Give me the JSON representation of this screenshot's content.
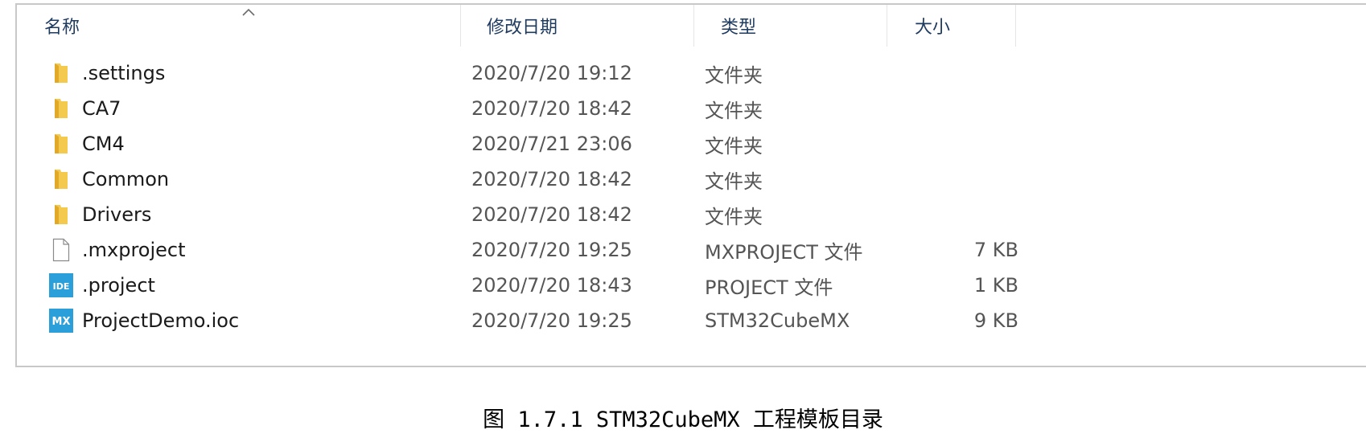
{
  "headers": {
    "name": "名称",
    "date": "修改日期",
    "type": "类型",
    "size": "大小"
  },
  "files": [
    {
      "name": ".settings",
      "date": "2020/7/20 19:12",
      "type": "文件夹",
      "size": "",
      "icon": "folder-icon"
    },
    {
      "name": "CA7",
      "date": "2020/7/20 18:42",
      "type": "文件夹",
      "size": "",
      "icon": "folder-icon"
    },
    {
      "name": "CM4",
      "date": "2020/7/21 23:06",
      "type": "文件夹",
      "size": "",
      "icon": "folder-icon"
    },
    {
      "name": "Common",
      "date": "2020/7/20 18:42",
      "type": "文件夹",
      "size": "",
      "icon": "folder-icon"
    },
    {
      "name": "Drivers",
      "date": "2020/7/20 18:42",
      "type": "文件夹",
      "size": "",
      "icon": "folder-icon"
    },
    {
      "name": ".mxproject",
      "date": "2020/7/20 19:25",
      "type": "MXPROJECT 文件",
      "size": "7 KB",
      "icon": "file-icon"
    },
    {
      "name": ".project",
      "date": "2020/7/20 18:43",
      "type": "PROJECT 文件",
      "size": "1 KB",
      "icon": "ide-icon"
    },
    {
      "name": "ProjectDemo.ioc",
      "date": "2020/7/20 19:25",
      "type": "STM32CubeMX",
      "size": "9 KB",
      "icon": "mx-icon"
    }
  ],
  "icon_labels": {
    "ide": "IDE",
    "mx": "MX"
  },
  "colors": {
    "folder": "#f3c94e",
    "folder_dark": "#e2a928",
    "app_icon": "#2b9fd9",
    "header_text": "#1e3a5f"
  },
  "caption": "图 1.7.1 STM32CubeMX 工程模板目录"
}
